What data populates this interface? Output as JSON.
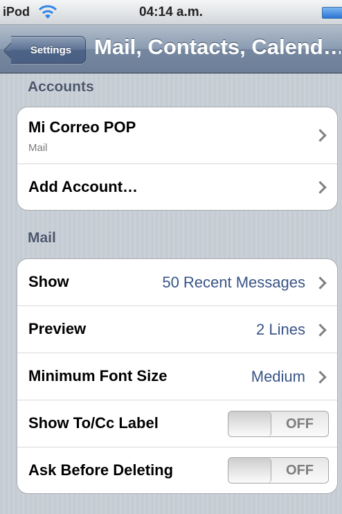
{
  "status_bar": {
    "carrier": "iPod",
    "time": "04:14 a.m."
  },
  "nav": {
    "back_label": "Settings",
    "title": "Mail, Contacts, Calend…"
  },
  "accounts_section": {
    "header": "Accounts",
    "rows": [
      {
        "label": "Mi Correo POP",
        "sublabel": "Mail"
      },
      {
        "label": "Add Account…"
      }
    ]
  },
  "mail_section": {
    "header": "Mail",
    "rows": [
      {
        "label": "Show",
        "value": "50 Recent Messages"
      },
      {
        "label": "Preview",
        "value": "2 Lines"
      },
      {
        "label": "Minimum Font Size",
        "value": "Medium"
      },
      {
        "label": "Show To/Cc Label",
        "toggle": "OFF"
      },
      {
        "label": "Ask Before Deleting",
        "toggle": "OFF"
      }
    ]
  },
  "colors": {
    "value_blue": "#385487",
    "section_header": "#4c566c",
    "background": "#c5ccd4"
  }
}
